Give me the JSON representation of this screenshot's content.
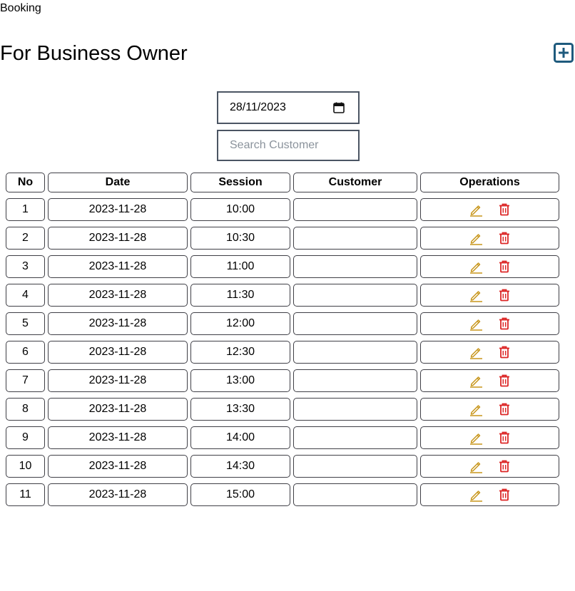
{
  "app": {
    "title": "Booking"
  },
  "header": {
    "title": "For Business Owner",
    "add_icon": "plus-square-icon"
  },
  "filters": {
    "date_value": "28/11/2023",
    "search_placeholder": "Search Customer",
    "search_value": ""
  },
  "table": {
    "columns": [
      "No",
      "Date",
      "Session",
      "Customer",
      "Operations"
    ],
    "rows": [
      {
        "no": "1",
        "date": "2023-11-28",
        "session": "10:00",
        "customer": ""
      },
      {
        "no": "2",
        "date": "2023-11-28",
        "session": "10:30",
        "customer": ""
      },
      {
        "no": "3",
        "date": "2023-11-28",
        "session": "11:00",
        "customer": ""
      },
      {
        "no": "4",
        "date": "2023-11-28",
        "session": "11:30",
        "customer": ""
      },
      {
        "no": "5",
        "date": "2023-11-28",
        "session": "12:00",
        "customer": ""
      },
      {
        "no": "6",
        "date": "2023-11-28",
        "session": "12:30",
        "customer": ""
      },
      {
        "no": "7",
        "date": "2023-11-28",
        "session": "13:00",
        "customer": ""
      },
      {
        "no": "8",
        "date": "2023-11-28",
        "session": "13:30",
        "customer": ""
      },
      {
        "no": "9",
        "date": "2023-11-28",
        "session": "14:00",
        "customer": ""
      },
      {
        "no": "10",
        "date": "2023-11-28",
        "session": "14:30",
        "customer": ""
      },
      {
        "no": "11",
        "date": "2023-11-28",
        "session": "15:00",
        "customer": ""
      }
    ],
    "operations": {
      "edit_icon": "pencil-icon",
      "delete_icon": "trash-icon"
    }
  },
  "colors": {
    "accent": "#1e5a7d",
    "edit": "#c8961c",
    "delete": "#dc2626",
    "border": "#3f3f46"
  }
}
